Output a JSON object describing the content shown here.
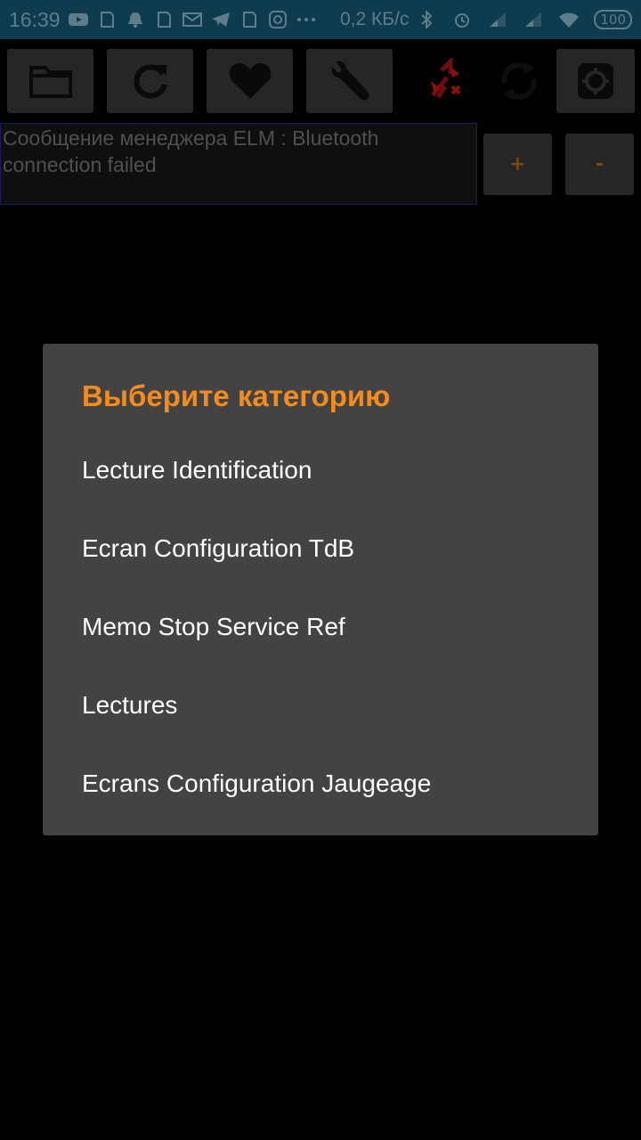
{
  "status_bar": {
    "time": "16:39",
    "network_speed": "0,2 КБ/с",
    "battery": "100",
    "icons": [
      "youtube-icon",
      "sim-icon",
      "bell-icon",
      "sim-icon",
      "mail-icon",
      "telegram-icon",
      "sim-icon",
      "instagram-icon",
      "more-dots-icon",
      "bluetooth-icon",
      "alarm-icon",
      "signal-icon",
      "signal-icon",
      "wifi-icon",
      "battery-icon"
    ]
  },
  "toolbar": {
    "buttons": [
      "folder-icon",
      "refresh-icon",
      "heart-icon",
      "wrench-icon",
      "bluetooth-disconnected-icon",
      "sync-icon",
      "settings-icon"
    ]
  },
  "message": {
    "text": "Сообщение менеджера ELM : Bluetooth connection failed"
  },
  "zoom": {
    "plus_label": "+",
    "minus_label": "-"
  },
  "dialog": {
    "title": "Выберите категорию",
    "items": [
      {
        "label": "Lecture Identification"
      },
      {
        "label": "Ecran Configuration TdB"
      },
      {
        "label": "Memo Stop Service Ref"
      },
      {
        "label": "Lectures"
      },
      {
        "label": "Ecrans Configuration Jaugeage"
      }
    ]
  },
  "colors": {
    "accent": "#f28c1c",
    "dialog_bg": "#434343",
    "status_bar_bg": "#0e3c4e",
    "button_bg": "#262626"
  }
}
